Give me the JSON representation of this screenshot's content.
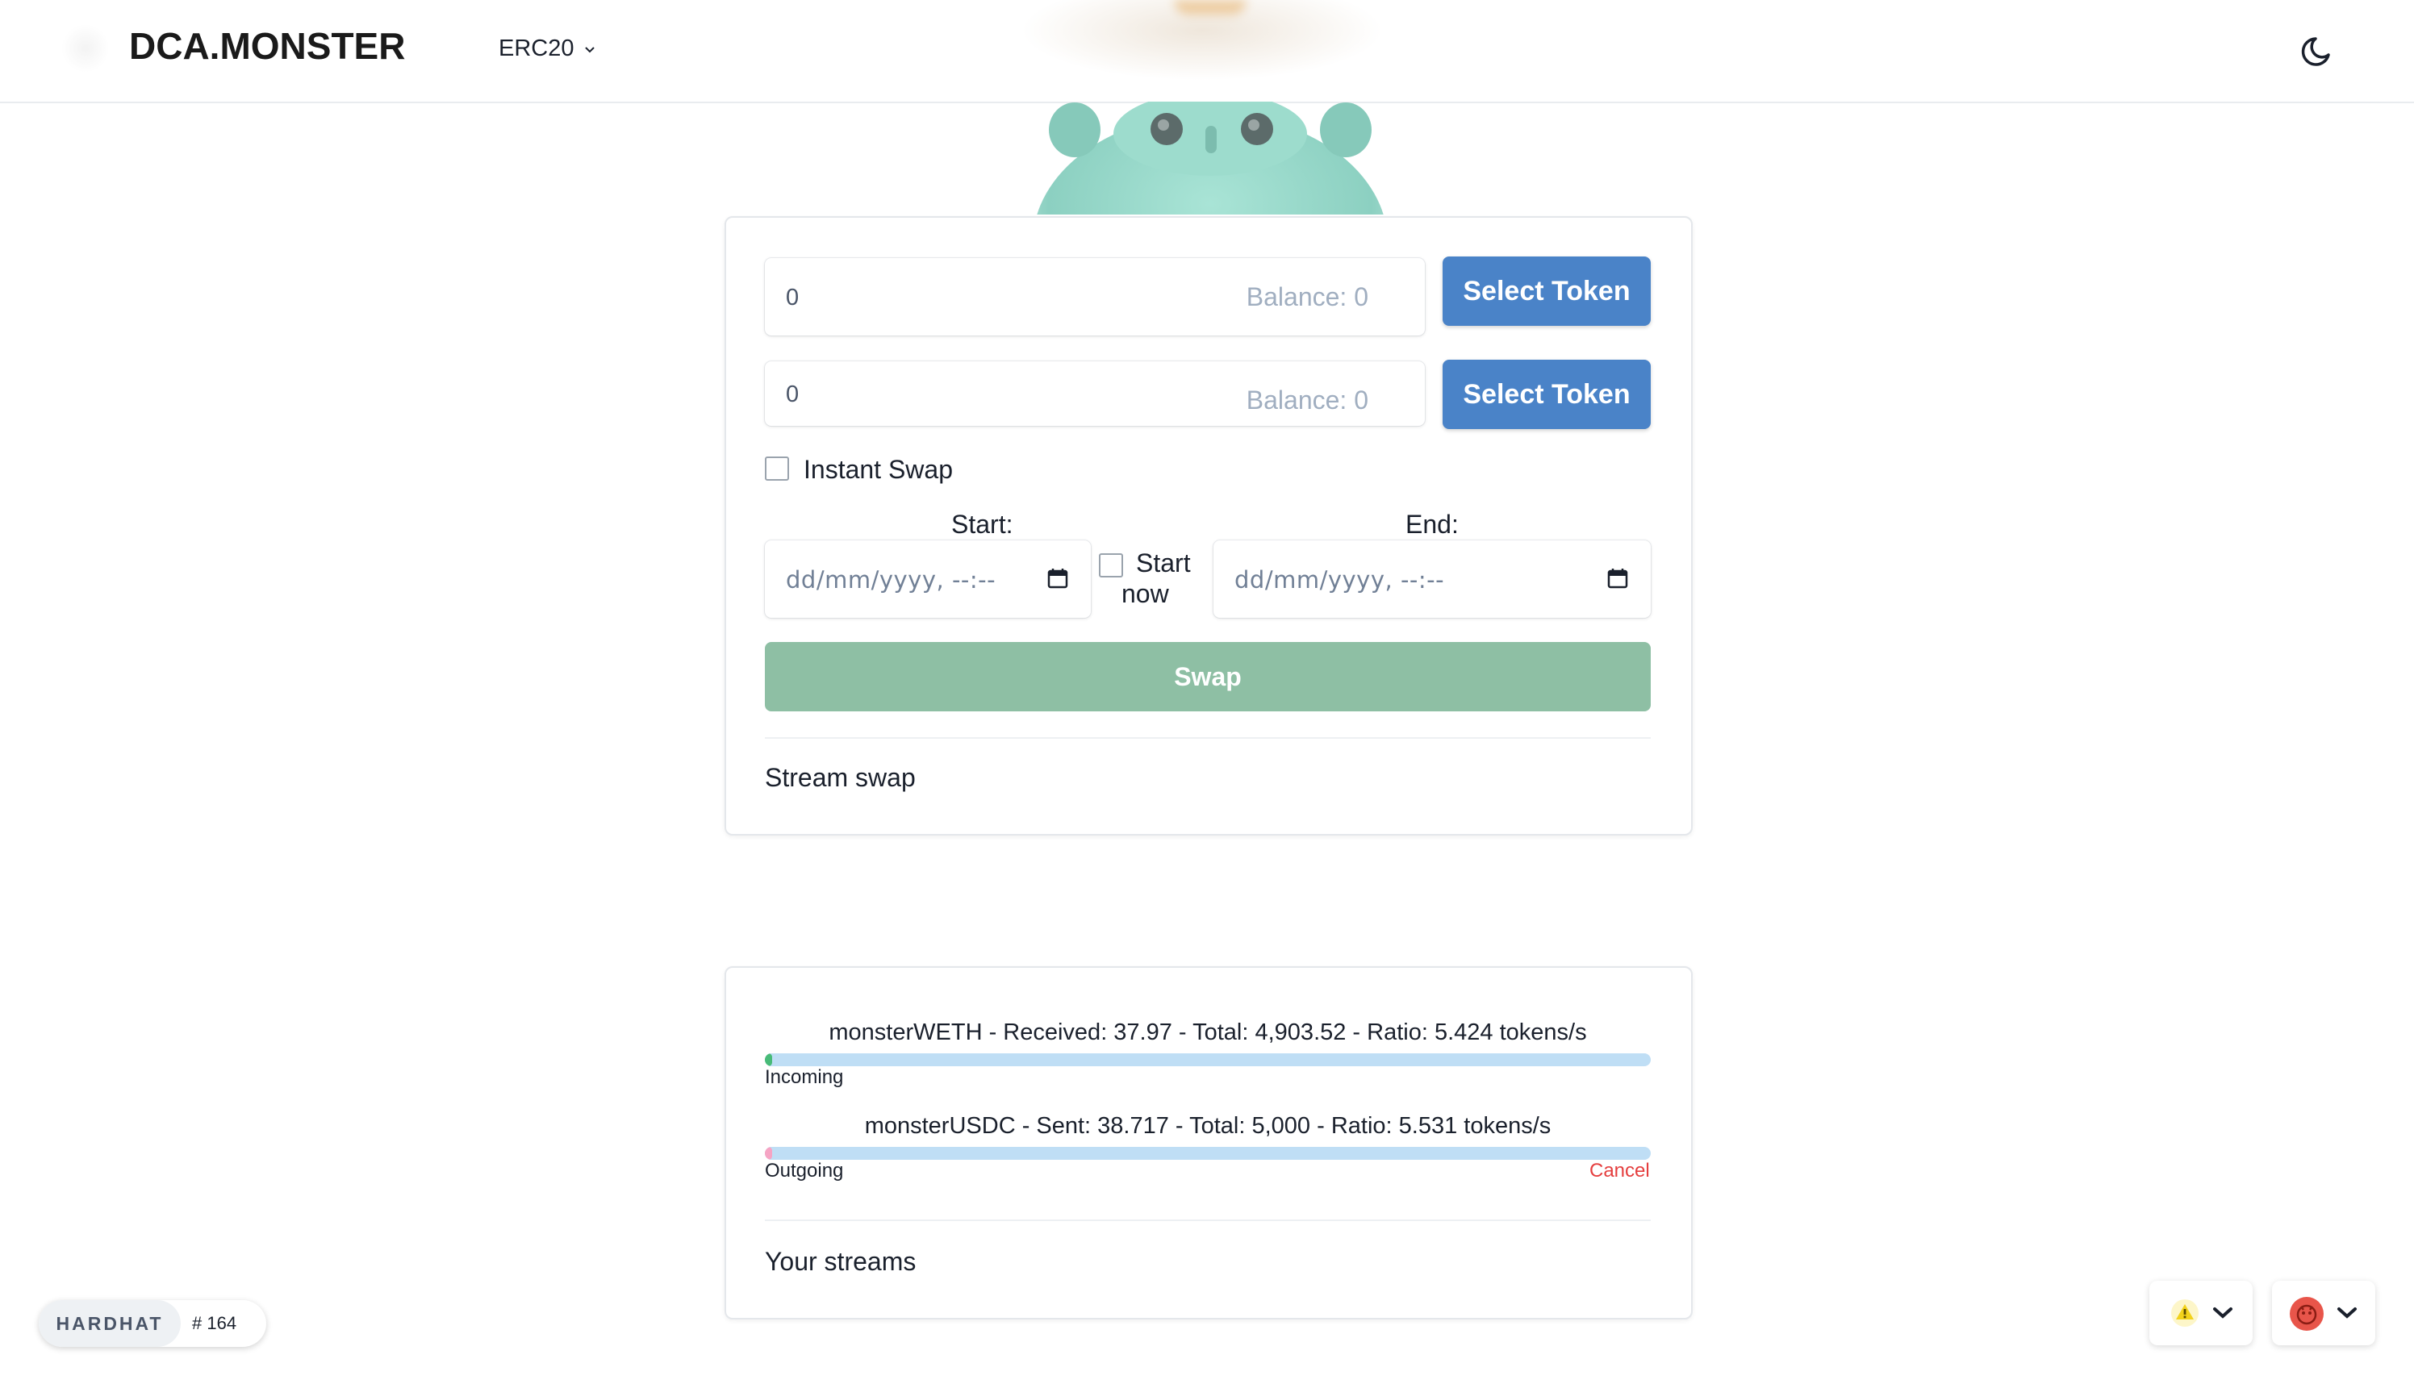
{
  "header": {
    "logo": "DCA.MONSTER",
    "network": "ERC20"
  },
  "swap_card": {
    "from_amount": {
      "placeholder": "0",
      "balance": "Balance: 0",
      "button": "Select Token"
    },
    "to_amount": {
      "placeholder": "0",
      "balance": "Balance: 0",
      "button": "Select Token"
    },
    "instant_swap_label": "Instant Swap",
    "start_label": "Start:",
    "end_label": "End:",
    "start_now_label_1": "Start",
    "start_now_label_2": "now",
    "start_date_placeholder": "dd/mm/yyyy, --:--",
    "end_date_placeholder": "dd/mm/yyyy, --:--",
    "swap_button": "Swap",
    "title": "Stream swap"
  },
  "streams_card": {
    "incoming": {
      "text": "monsterWETH - Received: 37.97 - Total: 4,903.52 - Ratio: 5.424 tokens/s",
      "label": "Incoming",
      "progress": 0.0077,
      "color": "#48bb78"
    },
    "outgoing": {
      "text": "monsterUSDC - Sent: 38.717 - Total: 5,000 - Ratio: 5.531 tokens/s",
      "label": "Outgoing",
      "cancel": "Cancel",
      "progress": 0.0077,
      "color": "#f6a4c4"
    },
    "title": "Your streams"
  },
  "hardhat_badge": {
    "name": "HARDHAT",
    "block": "# 164"
  },
  "colors": {
    "primary_button": "#4a83c8",
    "swap_button": "#8ebfa4",
    "progress_track": "#bfdef5",
    "cancel": "#e53e3e"
  },
  "icons": {
    "theme_toggle": "moon-icon",
    "network_dropdown": "chevron-down-icon",
    "calendar": "calendar-icon",
    "warning_network": "warning-icon",
    "account": "avatar-icon"
  }
}
